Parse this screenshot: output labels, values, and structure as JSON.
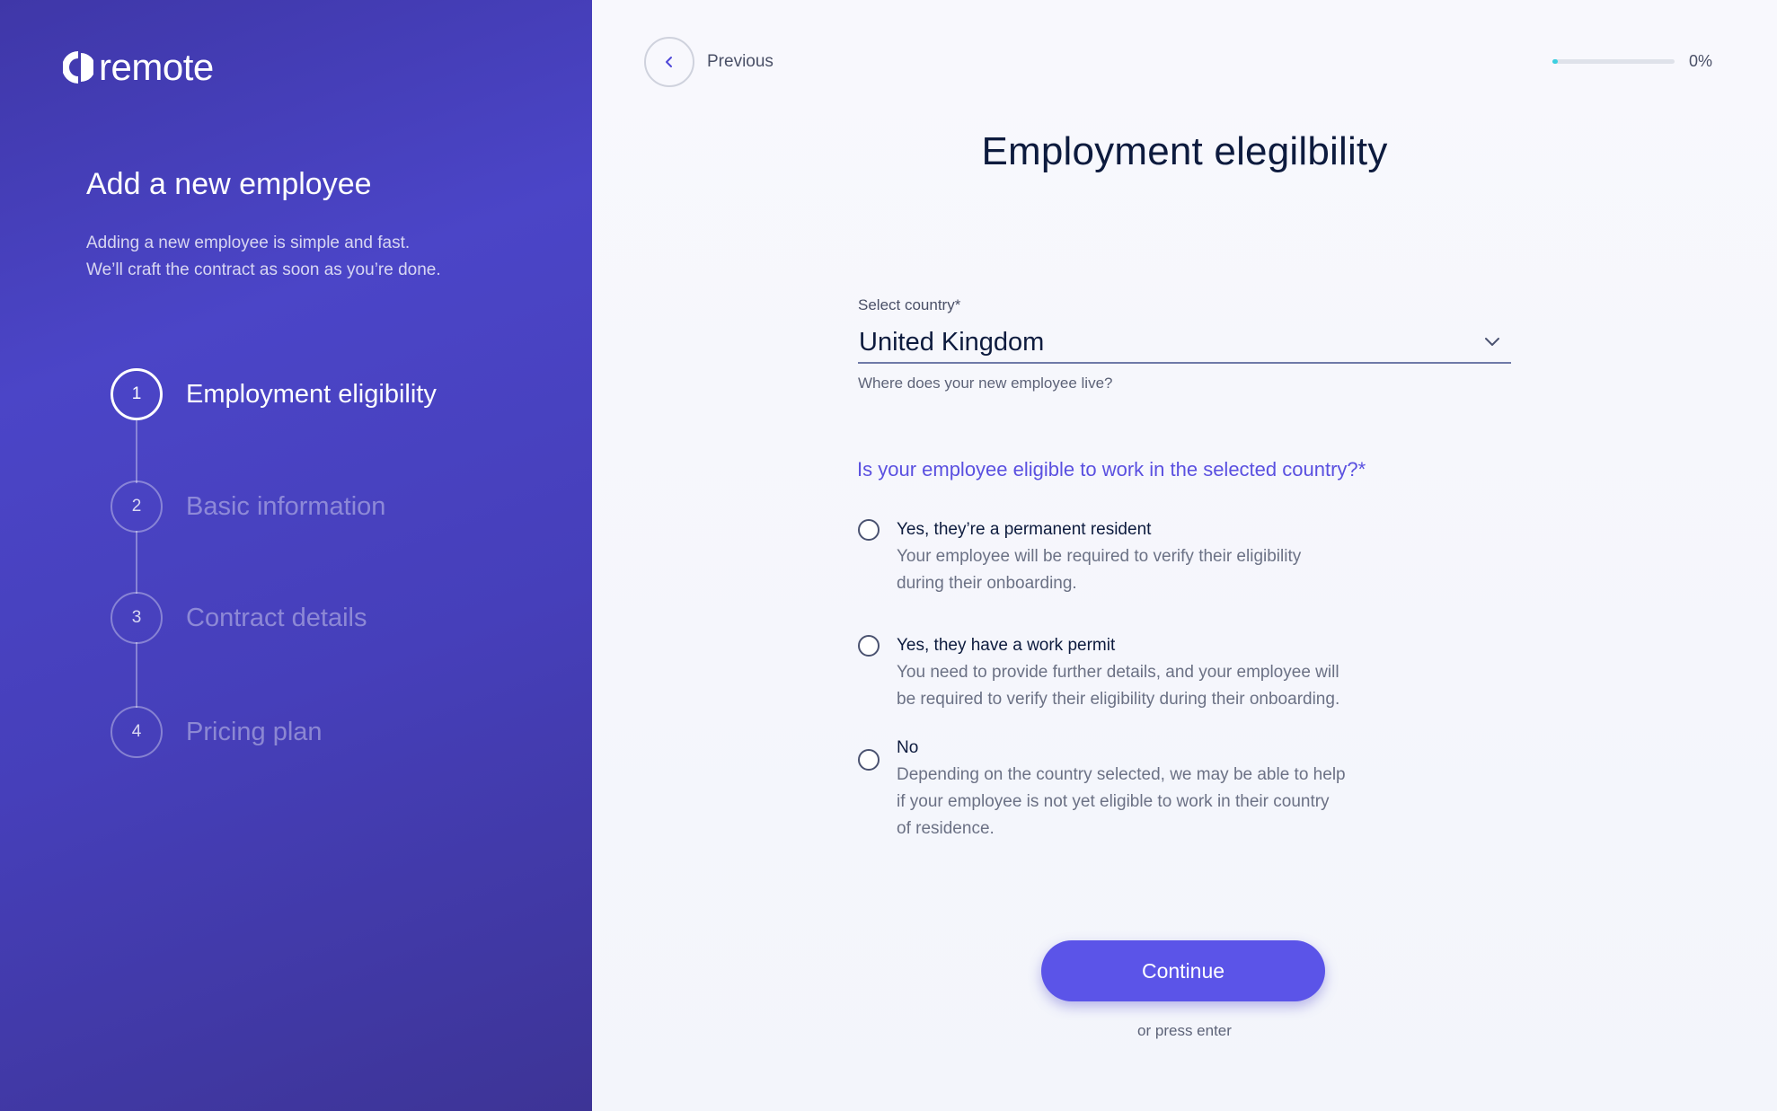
{
  "brand": {
    "logo_text": "remote"
  },
  "sidebar": {
    "title": "Add a new employee",
    "description_line1": "Adding a new employee is simple and fast.",
    "description_line2": "We’ll craft the contract as soon as you’re done.",
    "steps": [
      {
        "number": "1",
        "label": "Employment eligibility",
        "active": true
      },
      {
        "number": "2",
        "label": "Basic information",
        "active": false
      },
      {
        "number": "3",
        "label": "Contract details",
        "active": false
      },
      {
        "number": "4",
        "label": "Pricing plan",
        "active": false
      }
    ]
  },
  "header": {
    "previous_label": "Previous",
    "progress_percent": 0,
    "progress_text": "0%"
  },
  "main": {
    "title": "Employment elegilbility",
    "country_field": {
      "label": "Select country*",
      "value": "United Kingdom",
      "help": "Where does your new employee live?"
    },
    "question": "Is your employee eligible to work in the selected country?*",
    "options": [
      {
        "title": "Yes, they’re a permanent resident",
        "desc_lines": [
          "Your employee will be required to verify their eligibility",
          "during their onboarding."
        ]
      },
      {
        "title": "Yes, they have a work permit",
        "desc_lines": [
          "You need to provide further details, and your employee will",
          "be required to verify their eligibility during their onboarding."
        ]
      },
      {
        "title": "No",
        "desc_lines": [
          "Depending on the country selected, we may be able to help",
          "if your employee is not yet eligible to work in their country",
          "of residence."
        ]
      }
    ],
    "continue_label": "Continue",
    "press_enter": "or press enter"
  },
  "colors": {
    "accent": "#5b54e8",
    "sidebar_bg": "#4b45c7",
    "progress_fill": "#3ccfe0",
    "title_text": "#0d1b3e"
  },
  "icons": {
    "logo": "remote-logo-icon",
    "previous": "chevron-left-icon",
    "dropdown": "chevron-down-icon"
  }
}
